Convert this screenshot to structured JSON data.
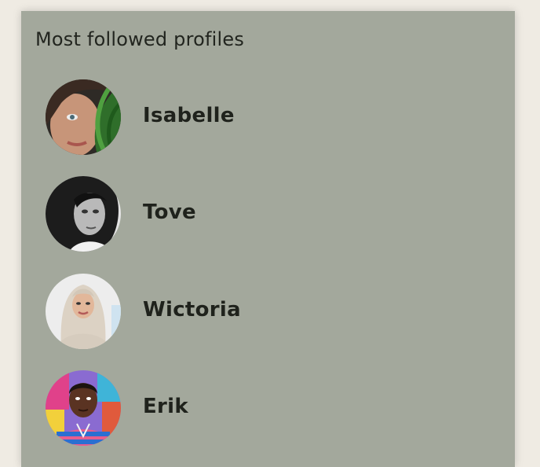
{
  "widget": {
    "title": "Most followed profiles"
  },
  "profiles": [
    {
      "name": "Isabelle",
      "avatar_icon": "portrait-woman-leaf-icon"
    },
    {
      "name": "Tove",
      "avatar_icon": "portrait-woman-curly-hair-icon"
    },
    {
      "name": "Wictoria",
      "avatar_icon": "portrait-woman-hijab-icon"
    },
    {
      "name": "Erik",
      "avatar_icon": "portrait-man-colorful-wall-icon"
    }
  ],
  "colors": {
    "page_background": "#efebe3",
    "card_background": "#a3a89c",
    "text": "#1f221c"
  }
}
